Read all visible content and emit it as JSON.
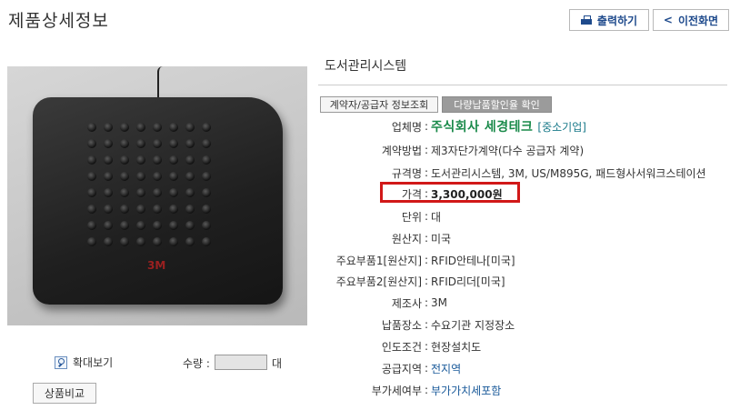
{
  "page": {
    "title": "제품상세정보"
  },
  "toolbar": {
    "print_label": "출력하기",
    "back_label": "이전화면"
  },
  "product": {
    "name": "도서관리시스템",
    "brand_mark": "3M",
    "actions": {
      "contract_info": "계약자/공급자 정보조회",
      "discount_check": "다량납품할인율 확인"
    },
    "fields": {
      "company": {
        "label": "업체명",
        "value": "주식회사 세경테크",
        "tag": "[중소기업]"
      },
      "contract_method": {
        "label": "계약방법",
        "value": "제3자단가계약(다수 공급자 계약)"
      },
      "spec": {
        "label": "규격명",
        "value": "도서관리시스템, 3M, US/M895G, 패드형사서워크스테이션"
      },
      "price": {
        "label": "가격",
        "value": "3,300,000원"
      },
      "unit": {
        "label": "단위",
        "value": "대"
      },
      "origin": {
        "label": "원산지",
        "value": "미국"
      },
      "part1": {
        "label": "주요부품1[원산지]",
        "value": "RFID안테나[미국]"
      },
      "part2": {
        "label": "주요부품2[원산지]",
        "value": "RFID리더[미국]"
      },
      "maker": {
        "label": "제조사",
        "value": "3M"
      },
      "delivery_place": {
        "label": "납품장소",
        "value": "수요기관 지정장소"
      },
      "delivery_terms": {
        "label": "인도조건",
        "value": "현장설치도"
      },
      "supply_region": {
        "label": "공급지역",
        "value": "전지역"
      },
      "vat": {
        "label": "부가세여부",
        "value": "부가가치세포함"
      }
    }
  },
  "controls": {
    "zoom_label": "확대보기",
    "qty_label": "수량 :",
    "qty_value": "",
    "qty_unit": "대",
    "compare_label": "상품비교"
  },
  "colors": {
    "accent_blue": "#1e4a8c",
    "company_green": "#1a8a4a",
    "highlight_red": "#d11818"
  }
}
